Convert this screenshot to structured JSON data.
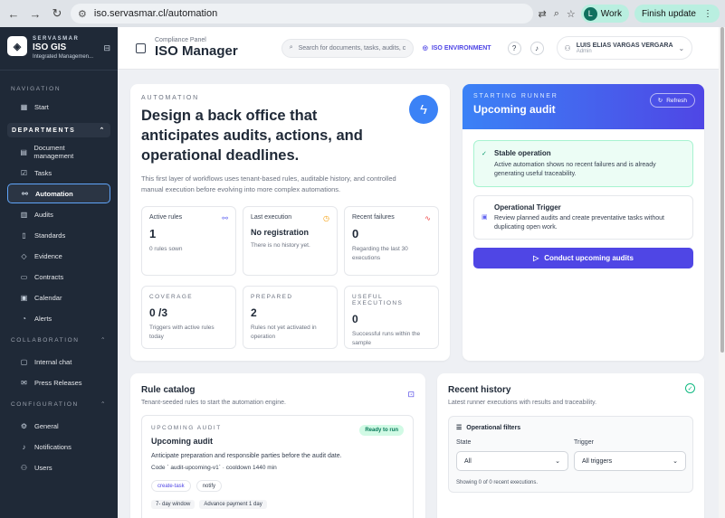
{
  "browser": {
    "url": "iso.servasmar.cl/automation",
    "profile_initial": "L",
    "profile_label": "Work",
    "update_label": "Finish update"
  },
  "sidebar": {
    "brand_kicker": "SERVASMAR",
    "brand_name": "ISO GIS",
    "brand_sub": "Integrated Managemen...",
    "nav_label": "NAVIGATION",
    "start": "Start",
    "departments_label": "DEPARTMENTS",
    "departments": [
      {
        "label": "Document management",
        "icon": "document-icon"
      },
      {
        "label": "Tasks",
        "icon": "checkbox-icon"
      },
      {
        "label": "Automation",
        "icon": "sliders-icon"
      },
      {
        "label": "Audits",
        "icon": "clipboard-icon"
      },
      {
        "label": "Standards",
        "icon": "book-icon"
      },
      {
        "label": "Evidence",
        "icon": "folder-icon"
      },
      {
        "label": "Contracts",
        "icon": "file-icon"
      },
      {
        "label": "Calendar",
        "icon": "calendar-icon"
      },
      {
        "label": "Alerts",
        "icon": "alert-icon"
      }
    ],
    "collaboration_label": "COLLABORATION",
    "collaboration": [
      {
        "label": "Internal chat",
        "icon": "chat-icon"
      },
      {
        "label": "Press Releases",
        "icon": "mail-icon"
      }
    ],
    "configuration_label": "CONFIGURATION",
    "configuration": [
      {
        "label": "General",
        "icon": "gear-icon"
      },
      {
        "label": "Notifications",
        "icon": "bell-icon"
      },
      {
        "label": "Users",
        "icon": "users-icon"
      }
    ]
  },
  "header": {
    "subtitle": "Compliance Panel",
    "title": "ISO Manager",
    "search_placeholder": "Search for documents, tasks, audits, c",
    "env_label": "ISO ENVIRONMENT",
    "user_name": "LUIS ELIAS VARGAS VERGARA",
    "user_role": "Admin"
  },
  "hero": {
    "kicker": "AUTOMATION",
    "title": "Design a back office that anticipates audits, actions, and operational deadlines.",
    "description": "This first layer of workflows uses tenant-based rules, auditable history, and controlled manual execution before evolving into more complex automations.",
    "stats": [
      {
        "label": "Active rules",
        "value": "1",
        "desc": "0 rules sown"
      },
      {
        "label": "Last execution",
        "value": "No registration",
        "desc": "There is no history yet."
      },
      {
        "label": "Recent failures",
        "value": "0",
        "desc": "Regarding the last 30 executions"
      }
    ],
    "metrics": [
      {
        "label": "COVERAGE",
        "value": "0 /3",
        "desc": "Triggers with active rules today"
      },
      {
        "label": "PREPARED",
        "value": "2",
        "desc": "Rules not yet activated in operation"
      },
      {
        "label": "USEFUL EXECUTIONS",
        "value": "0",
        "desc": "Successful runs within the sample"
      }
    ]
  },
  "runner": {
    "kicker": "STARTING RUNNER",
    "title": "Upcoming audit",
    "refresh": "Refresh",
    "status_title": "Stable operation",
    "status_text": "Active automation shows no recent failures and is already generating useful traceability.",
    "trigger_title": "Operational Trigger",
    "trigger_text": "Review planned audits and create preventative tasks without duplicating open work.",
    "cta": "Conduct upcoming audits"
  },
  "catalog": {
    "title": "Rule catalog",
    "desc": "Tenant-seeded rules to start the automation engine.",
    "rule": {
      "kicker": "UPCOMING AUDIT",
      "badge": "Ready to run",
      "title": "Upcoming audit",
      "desc": "Anticipate preparation and responsible parties before the audit date.",
      "code": "Code ` audit-upcoming-v1` · cooldown 1440 min",
      "tags": [
        "create-task",
        "notify"
      ],
      "meta": [
        "7- day window",
        "Advance payment 1 day"
      ]
    }
  },
  "history": {
    "title": "Recent history",
    "desc": "Latest runner executions with results and traceability.",
    "filters_title": "Operational filters",
    "state_label": "State",
    "state_value": "All",
    "trigger_label": "Trigger",
    "trigger_value": "All triggers",
    "note": "Showing 0 of 0 recent executions."
  }
}
